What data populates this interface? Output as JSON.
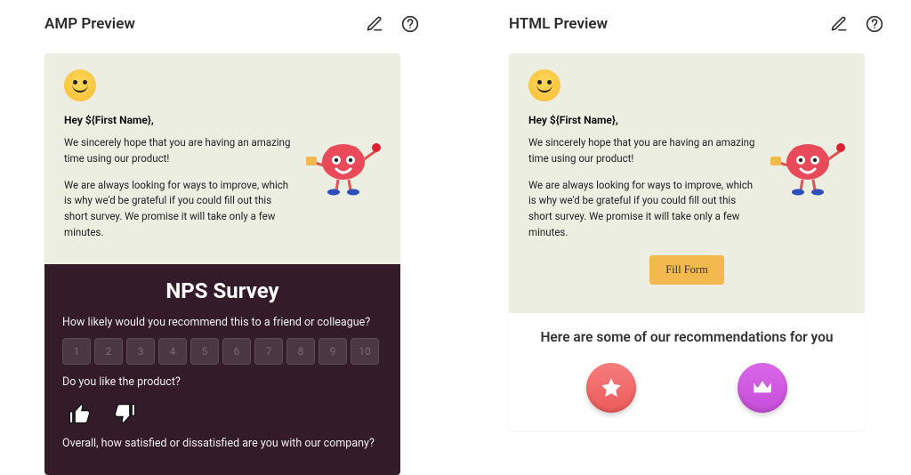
{
  "panels": [
    {
      "title": "AMP Preview"
    },
    {
      "title": "HTML Preview"
    }
  ],
  "email": {
    "greeting": "Hey ${First Name},",
    "para1": "We sincerely hope that you are having an amazing time using our product!",
    "para2": "We are always looking for ways to improve, which is why we'd be grateful if you could fill out this short survey. We promise it will take only a few minutes."
  },
  "survey": {
    "title": "NPS Survey",
    "q1": "How likely would you recommend this to a friend or colleague?",
    "scale": [
      "1",
      "2",
      "3",
      "4",
      "5",
      "6",
      "7",
      "8",
      "9",
      "10"
    ],
    "q2": "Do you like the product?",
    "q3": "Overall, how satisfied or dissatisfied are you with our company?"
  },
  "htmlVariant": {
    "fill_button": "Fill Form",
    "recs_title": "Here are some of our recommendations for you"
  }
}
